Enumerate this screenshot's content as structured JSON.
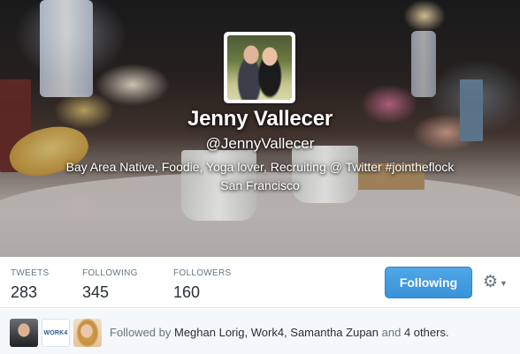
{
  "profile": {
    "name": "Jenny Vallecer",
    "handle": "@JennyVallecer",
    "bio": "Bay Area Native, Foodie, Yoga lover, Recruiting @ Twitter #jointheflock",
    "location": "San Francisco"
  },
  "stats": {
    "tweets_label": "TWEETS",
    "tweets_value": "283",
    "following_label": "FOLLOWING",
    "following_value": "345",
    "followers_label": "FOLLOWERS",
    "followers_value": "160"
  },
  "actions": {
    "follow_button_label": "Following",
    "settings_icon": "gear-icon",
    "settings_caret_icon": "chevron-down-icon"
  },
  "followed_by": {
    "prefix": "Followed by",
    "names": "Meghan Lorig, Work4, Samantha Zupan",
    "conjunction": "and",
    "others": "4 others.",
    "work4_logo_text": "WORK4"
  },
  "colors": {
    "accent": "#3a92d8",
    "text_muted": "#66757f",
    "text_dark": "#292f33",
    "followed_bg": "#f5f8fa"
  }
}
